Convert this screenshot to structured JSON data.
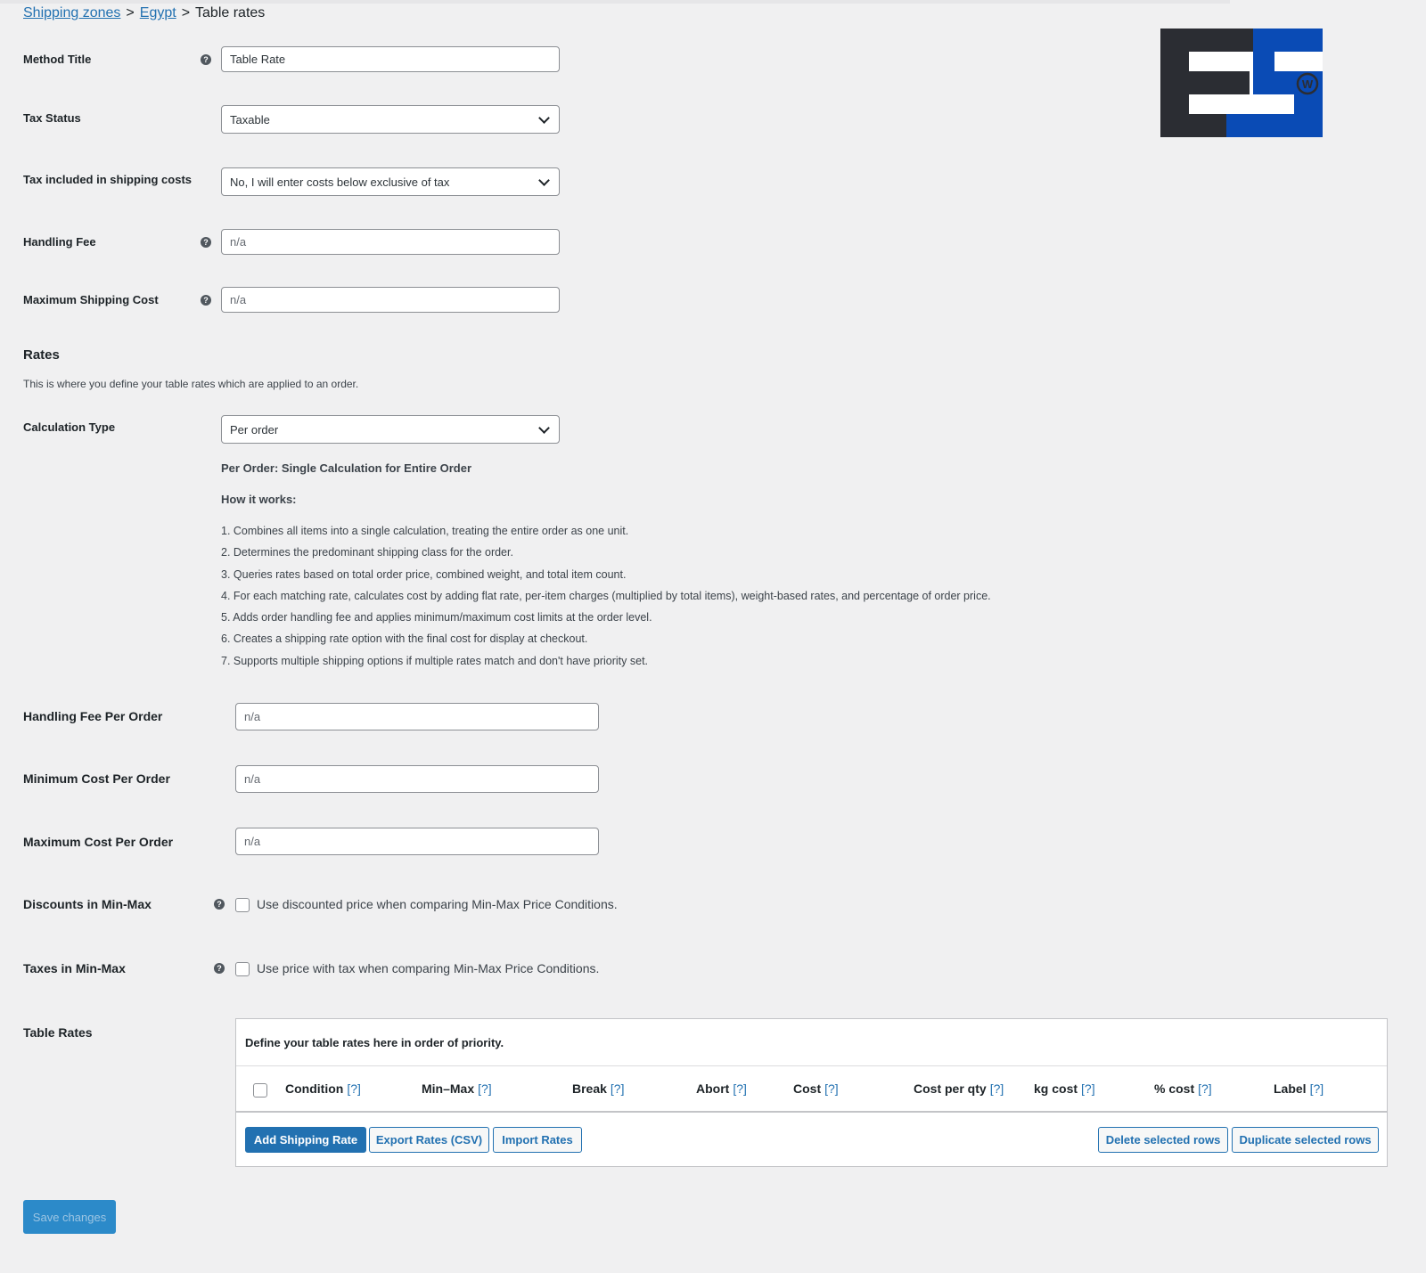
{
  "breadcrumb": {
    "items": [
      "Shipping zones",
      "Egypt"
    ],
    "separator": ">",
    "current": "Table rates"
  },
  "settings": {
    "method_title": {
      "label": "Method Title",
      "value": "Table Rate"
    },
    "tax_status": {
      "label": "Tax Status",
      "value": "Taxable"
    },
    "tax_included": {
      "label": "Tax included in shipping costs",
      "value": "No, I will enter costs below exclusive of tax"
    },
    "handling_fee": {
      "label": "Handling Fee",
      "placeholder": "n/a"
    },
    "max_shipping_cost": {
      "label": "Maximum Shipping Cost",
      "placeholder": "n/a"
    }
  },
  "rates": {
    "heading": "Rates",
    "description": "This is where you define your table rates which are applied to an order.",
    "calculation_type": {
      "label": "Calculation Type",
      "value": "Per order"
    },
    "info_title": "Per Order: Single Calculation for Entire Order",
    "how_title": "How it works:",
    "how_steps": [
      "1. Combines all items into a single calculation, treating the entire order as one unit.",
      "2. Determines the predominant shipping class for the order.",
      "3. Queries rates based on total order price, combined weight, and total item count.",
      "4. For each matching rate, calculates cost by adding flat rate, per-item charges (multiplied by total items), weight-based rates, and percentage of order price.",
      "5. Adds order handling fee and applies minimum/maximum cost limits at the order level.",
      "6. Creates a shipping rate option with the final cost for display at checkout.",
      "7. Supports multiple shipping options if multiple rates match and don't have priority set."
    ]
  },
  "order_fields": {
    "handling_fee_per_order": {
      "label": "Handling Fee Per Order",
      "placeholder": "n/a"
    },
    "min_cost_per_order": {
      "label": "Minimum Cost Per Order",
      "placeholder": "n/a"
    },
    "max_cost_per_order": {
      "label": "Maximum Cost Per Order",
      "placeholder": "n/a"
    }
  },
  "discounts_minmax": {
    "label": "Discounts in Min-Max",
    "checkbox_text": "Use discounted price when comparing Min-Max Price Conditions.",
    "checked": false
  },
  "taxes_minmax": {
    "label": "Taxes in Min-Max",
    "checkbox_text": "Use price with tax when comparing Min-Max Price Conditions.",
    "checked": false
  },
  "table_rates": {
    "label": "Table Rates",
    "intro": "Define your table rates here in order of priority.",
    "help_marker": "[?]",
    "columns": [
      "Condition",
      "Min–Max",
      "Break",
      "Abort",
      "Cost",
      "Cost per qty",
      "kg cost",
      "% cost",
      "Label"
    ],
    "buttons": {
      "add": "Add Shipping Rate",
      "export": "Export Rates (CSV)",
      "import": "Import Rates",
      "delete": "Delete selected rows",
      "duplicate": "Duplicate selected rows"
    }
  },
  "footer": {
    "save_label": "Save changes"
  },
  "help_icon_glyph": "?",
  "logo": {
    "text": "EG",
    "colors": {
      "dark": "#2b2d33",
      "blue": "#0a4bb5"
    },
    "badge": "W"
  },
  "colors": {
    "link": "#2271b1",
    "background": "#f0f0f1",
    "save_button": "#2c8ac9"
  }
}
